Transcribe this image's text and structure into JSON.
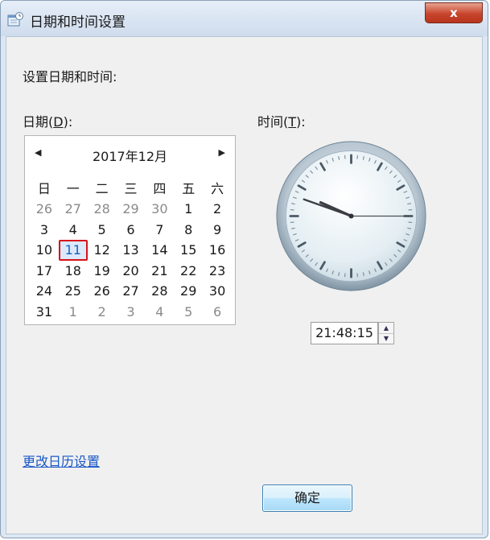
{
  "window": {
    "title": "日期和时间设置",
    "close_symbol": "x",
    "app_icon": "calendar-clock-icon"
  },
  "heading": "设置日期和时间:",
  "date_section": {
    "label_prefix": "日期(",
    "label_accel": "D",
    "label_suffix": "):"
  },
  "time_section": {
    "label_prefix": "时间(",
    "label_accel": "T",
    "label_suffix": "):"
  },
  "calendar": {
    "prev_symbol": "◀",
    "next_symbol": "▶",
    "month_title": "2017年12月",
    "weekdays": [
      "日",
      "一",
      "二",
      "三",
      "四",
      "五",
      "六"
    ],
    "days": [
      {
        "d": "26",
        "other": true
      },
      {
        "d": "27",
        "other": true
      },
      {
        "d": "28",
        "other": true
      },
      {
        "d": "29",
        "other": true
      },
      {
        "d": "30",
        "other": true
      },
      {
        "d": "1"
      },
      {
        "d": "2"
      },
      {
        "d": "3"
      },
      {
        "d": "4"
      },
      {
        "d": "5"
      },
      {
        "d": "6"
      },
      {
        "d": "7"
      },
      {
        "d": "8"
      },
      {
        "d": "9"
      },
      {
        "d": "10"
      },
      {
        "d": "11",
        "selected": true
      },
      {
        "d": "12"
      },
      {
        "d": "13"
      },
      {
        "d": "14"
      },
      {
        "d": "15"
      },
      {
        "d": "16"
      },
      {
        "d": "17"
      },
      {
        "d": "18"
      },
      {
        "d": "19"
      },
      {
        "d": "20"
      },
      {
        "d": "21"
      },
      {
        "d": "22"
      },
      {
        "d": "23"
      },
      {
        "d": "24"
      },
      {
        "d": "25"
      },
      {
        "d": "26"
      },
      {
        "d": "27"
      },
      {
        "d": "28"
      },
      {
        "d": "29"
      },
      {
        "d": "30"
      },
      {
        "d": "31"
      },
      {
        "d": "1",
        "other": true
      },
      {
        "d": "2",
        "other": true
      },
      {
        "d": "3",
        "other": true
      },
      {
        "d": "4",
        "other": true
      },
      {
        "d": "5",
        "other": true
      },
      {
        "d": "6",
        "other": true
      }
    ]
  },
  "clock": {
    "hour": 21,
    "minute": 48,
    "second": 15
  },
  "time_value": "21:48:15",
  "spinner": {
    "up_symbol": "▲",
    "down_symbol": "▼"
  },
  "calendar_settings_link": "更改日历设置",
  "ok_label": "确定",
  "colors": {
    "link": "#1a58c8",
    "selection_border": "#d8121b",
    "close_button": "#c8452c"
  }
}
